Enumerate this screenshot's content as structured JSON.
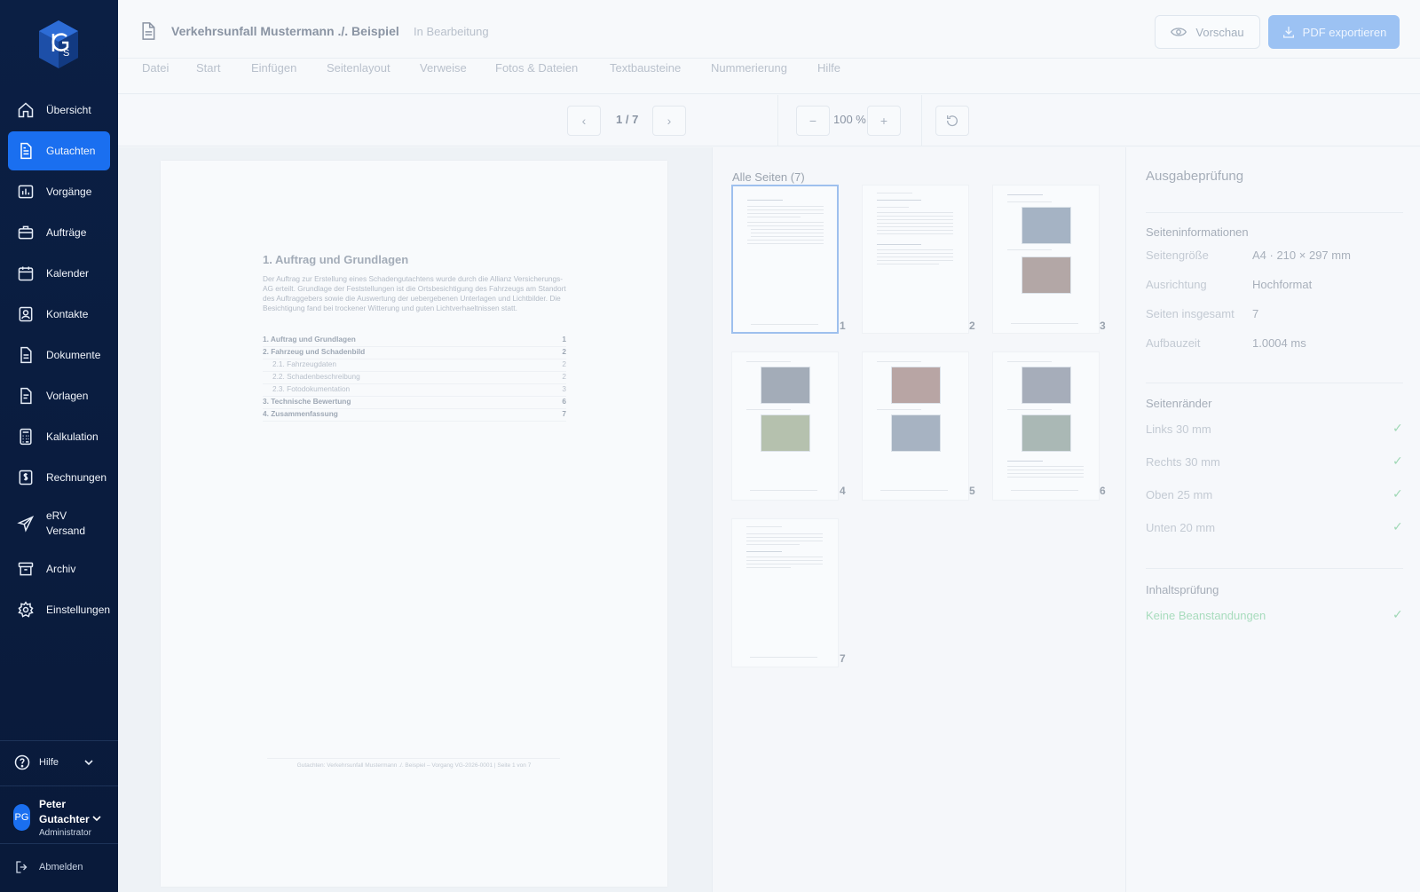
{
  "sidebar": {
    "items": [
      {
        "label": "Übersicht"
      },
      {
        "label": "Gutachten"
      },
      {
        "label": "Vorgänge"
      },
      {
        "label": "Aufträge"
      },
      {
        "label": "Kalender"
      },
      {
        "label": "Kontakte"
      },
      {
        "label": "Dokumente"
      },
      {
        "label": "Vorlagen"
      },
      {
        "label": "Kalkulation"
      },
      {
        "label": "Rechnungen"
      },
      {
        "label": "eRV Versand"
      },
      {
        "label": "Archiv"
      },
      {
        "label": "Einstellungen"
      }
    ],
    "active_item": "Gutachten",
    "help_label": "Hilfe",
    "user": {
      "initials": "PG",
      "name": "Peter Gutachter",
      "role": "Administrator"
    },
    "logout_label": "Abmelden"
  },
  "header": {
    "title": "Verkehrsunfall Mustermann ./. Beispiel",
    "status": "In Bearbeitung",
    "preview_label": "Vorschau",
    "export_label": "PDF exportieren"
  },
  "menu": [
    "Datei",
    "Start",
    "Einfügen",
    "Seitenlayout",
    "Verweise",
    "Fotos & Dateien",
    "Textbausteine",
    "Nummerierung",
    "Hilfe"
  ],
  "toolbar": {
    "prev": "‹",
    "page_indicator": "1 / 7",
    "next": "›",
    "zoom_out": "−",
    "zoom": "100 %",
    "zoom_in": "+"
  },
  "page": {
    "heading": "1. Auftrag und Grundlagen",
    "intro": "Der Auftrag zur Erstellung eines Schadengutachtens wurde durch die Allianz Versicherungs-AG erteilt. Grundlage der Feststellungen ist die Ortsbesichtigung des Fahrzeugs am Standort des Auftraggebers sowie die Auswertung der uebergebenen Unterlagen und Lichtbilder. Die Besichtigung fand bei trockener Witterung und guten Lichtverhaeltnissen statt.",
    "toc": [
      {
        "label": "1. Auftrag und Grundlagen",
        "page": "1",
        "level": 1
      },
      {
        "label": "2. Fahrzeug und Schadenbild",
        "page": "2",
        "level": 1
      },
      {
        "label": "2.1. Fahrzeugdaten",
        "page": "2",
        "level": 2
      },
      {
        "label": "2.2. Schadenbeschreibung",
        "page": "2",
        "level": 2
      },
      {
        "label": "2.3. Fotodokumentation",
        "page": "3",
        "level": 2
      },
      {
        "label": "3. Technische Bewertung",
        "page": "6",
        "level": 1
      },
      {
        "label": "4. Zusammenfassung",
        "page": "7",
        "level": 1
      }
    ],
    "footer": "Gutachten: Verkehrsunfall Mustermann ./. Beispiel – Vorgang VG-2026-0001 | Seite 1 von 7"
  },
  "thumbnails": {
    "title": "Alle Seiten (7)",
    "pages": [
      "1",
      "2",
      "3",
      "4",
      "5",
      "6",
      "7"
    ],
    "active_page": "1"
  },
  "output_check": {
    "title": "Ausgabeprüfung",
    "page_info": {
      "heading": "Seiteninformationen",
      "rows": [
        {
          "key": "Seitengröße",
          "value": "A4 · 210 × 297 mm"
        },
        {
          "key": "Ausrichtung",
          "value": "Hochformat"
        },
        {
          "key": "Seiten insgesamt",
          "value": "7"
        },
        {
          "key": "Aufbauzeit",
          "value": "1.0004 ms"
        }
      ]
    },
    "margins": {
      "heading": "Seitenränder",
      "rows": [
        {
          "label": "Links 30 mm",
          "ok": "✓"
        },
        {
          "label": "Rechts 30 mm",
          "ok": "✓"
        },
        {
          "label": "Oben 25 mm",
          "ok": "✓"
        },
        {
          "label": "Unten 20 mm",
          "ok": "✓"
        }
      ]
    },
    "content": {
      "heading": "Inhaltsprüfung",
      "result": "Keine Beanstandungen",
      "ok": "✓"
    }
  },
  "colors": {
    "sidebar_bg": "#0b1f44",
    "accent": "#1a6ff0",
    "export_button": "#9cc2f3",
    "ok_green": "#9fd8b5"
  }
}
